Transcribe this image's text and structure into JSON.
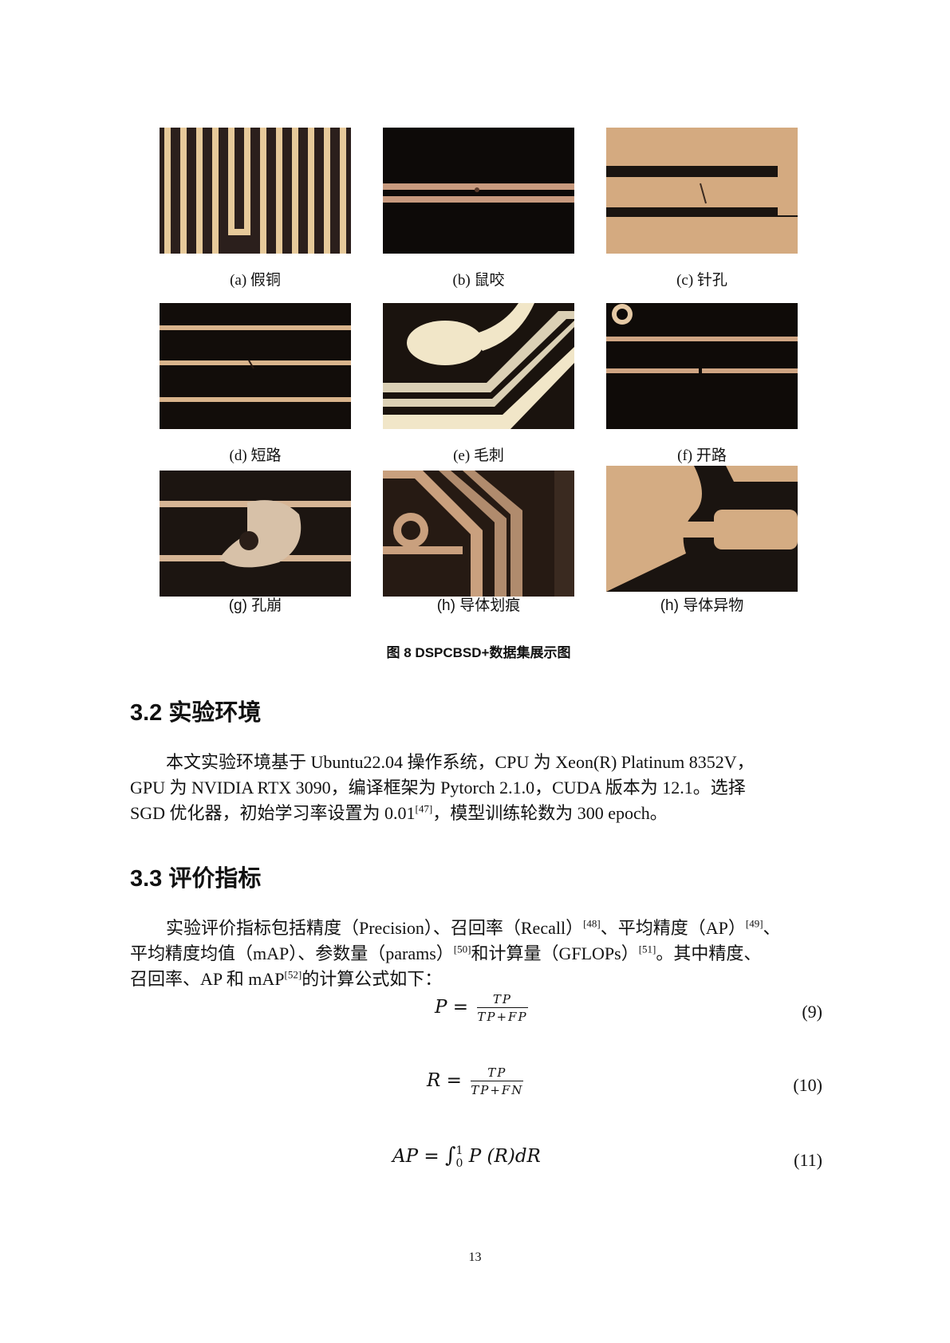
{
  "figure": {
    "panels": [
      {
        "caption": "(a) 假铜"
      },
      {
        "caption": "(b) 鼠咬"
      },
      {
        "caption": "(c) 针孔"
      },
      {
        "caption": "(d) 短路"
      },
      {
        "caption": "(e) 毛刺"
      },
      {
        "caption": "(f) 开路"
      },
      {
        "caption": "(g) 孔崩"
      },
      {
        "caption": "(h) 导体划痕"
      },
      {
        "caption": "(h) 导体异物"
      }
    ],
    "title": "图 8 DSPCBSD+数据集展示图"
  },
  "section_32": {
    "heading": "3.2  实验环境",
    "lines": [
      "本文实验环境基于 Ubuntu22.04 操作系统，CPU 为 Xeon(R) Platinum 8352V，",
      "GPU 为 NVIDIA RTX 3090，编译框架为 Pytorch 2.1.0，CUDA 版本为 12.1。选择",
      "SGD 优化器，初始学习率设置为 0.01",
      "，模型训练轮数为 300 epoch。"
    ],
    "refs": [
      "[47]"
    ]
  },
  "section_33": {
    "heading": "3.3  评价指标",
    "l1a": "实验评价指标包括精度（Precision）、召回率（Recall）",
    "r48": "[48]",
    "l1b": "、平均精度（AP）",
    "r49": "[49]",
    "l1c": "、",
    "l2a": "平均精度均值（mAP）、参数量（params）",
    "r50": "[50]",
    "l2b": "和计算量（GFLOPs）",
    "r51": "[51]",
    "l2c": "。其中精度、",
    "l3a": "召回率、AP 和 mAP",
    "r52": "[52]",
    "l3b": "的计算公式如下："
  },
  "equations": {
    "eq9": {
      "lhs": "P =",
      "num": "TP",
      "den": "TP+FP",
      "number": "(9)"
    },
    "eq10": {
      "lhs": "R =",
      "num": "TP",
      "den": "TP+FN",
      "number": "(10)"
    },
    "eq11": {
      "lhs": "AP =",
      "int": "∫",
      "upper": "1",
      "lower": "0",
      "body": "P (R)dR",
      "number": "(11)"
    }
  },
  "page_number": "13"
}
